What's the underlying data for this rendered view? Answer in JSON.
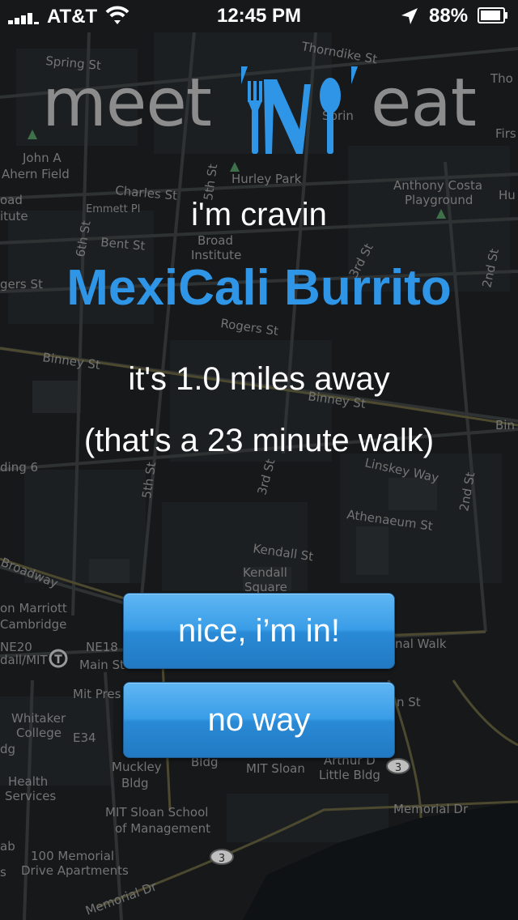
{
  "status_bar": {
    "carrier": "AT&T",
    "time": "12:45 PM",
    "battery": "88%",
    "icons": [
      "signal-icon",
      "wifi-icon",
      "location-arrow-icon",
      "battery-icon"
    ]
  },
  "logo": {
    "left_word": "meet",
    "right_word": "eat",
    "mark": "'N'",
    "mark_icons": [
      "fork-icon",
      "knife-icon",
      "spoon-icon"
    ]
  },
  "main": {
    "craving_label": "i'm cravin",
    "dish_name": "MexiCali Burrito",
    "distance_text": "it's 1.0 miles away",
    "walk_text": "(that's a 23 minute walk)"
  },
  "actions": {
    "accept_label": "nice, i’m in!",
    "decline_label": "no way"
  },
  "map_labels": [
    "Thorndike St",
    "Spring St",
    "Sprin",
    "Tho",
    "Firs",
    "John A",
    "Ahern Field",
    "Charles St",
    "Hurley Park",
    "Anthony Costa",
    "Playground",
    "Hu",
    "Emmett Pl",
    "oad",
    "itute",
    "6th St",
    "5th St",
    "Broad",
    "Institute",
    "Bent St",
    "3rd St",
    "2nd St",
    "gers St",
    "Rogers St",
    "Binney St",
    "Binney St",
    "Bin",
    "ding 6",
    "5th St",
    "3rd St",
    "Linskey Way",
    "2nd St",
    "Athenaeum St",
    "Kendall St",
    "Kendall",
    "Square",
    "Broadway",
    "on Marriott",
    "Cambridge",
    "NE20",
    "NE18",
    "dall/MIT",
    "Main St",
    "nal Walk",
    "Mit Pres",
    "n St",
    "Whitaker",
    "College",
    "E34",
    "dg",
    "Muckley",
    "Bldg",
    "Bldg",
    "MIT Sloan",
    "Arthur D",
    "Little Bldg",
    "Health",
    "Services",
    "Memorial Dr",
    "MIT Sloan School",
    "of Management",
    "ab",
    "100 Memorial",
    "s",
    "Drive Apartments",
    "Memorial Dr"
  ],
  "map_shields": [
    "3",
    "3"
  ],
  "colors": {
    "accent": "#2f95e6",
    "logo_gray": "#8c8c8c",
    "button_top": "#60b6f3",
    "button_bottom": "#2179c2",
    "map_background": "#1b1e20"
  }
}
